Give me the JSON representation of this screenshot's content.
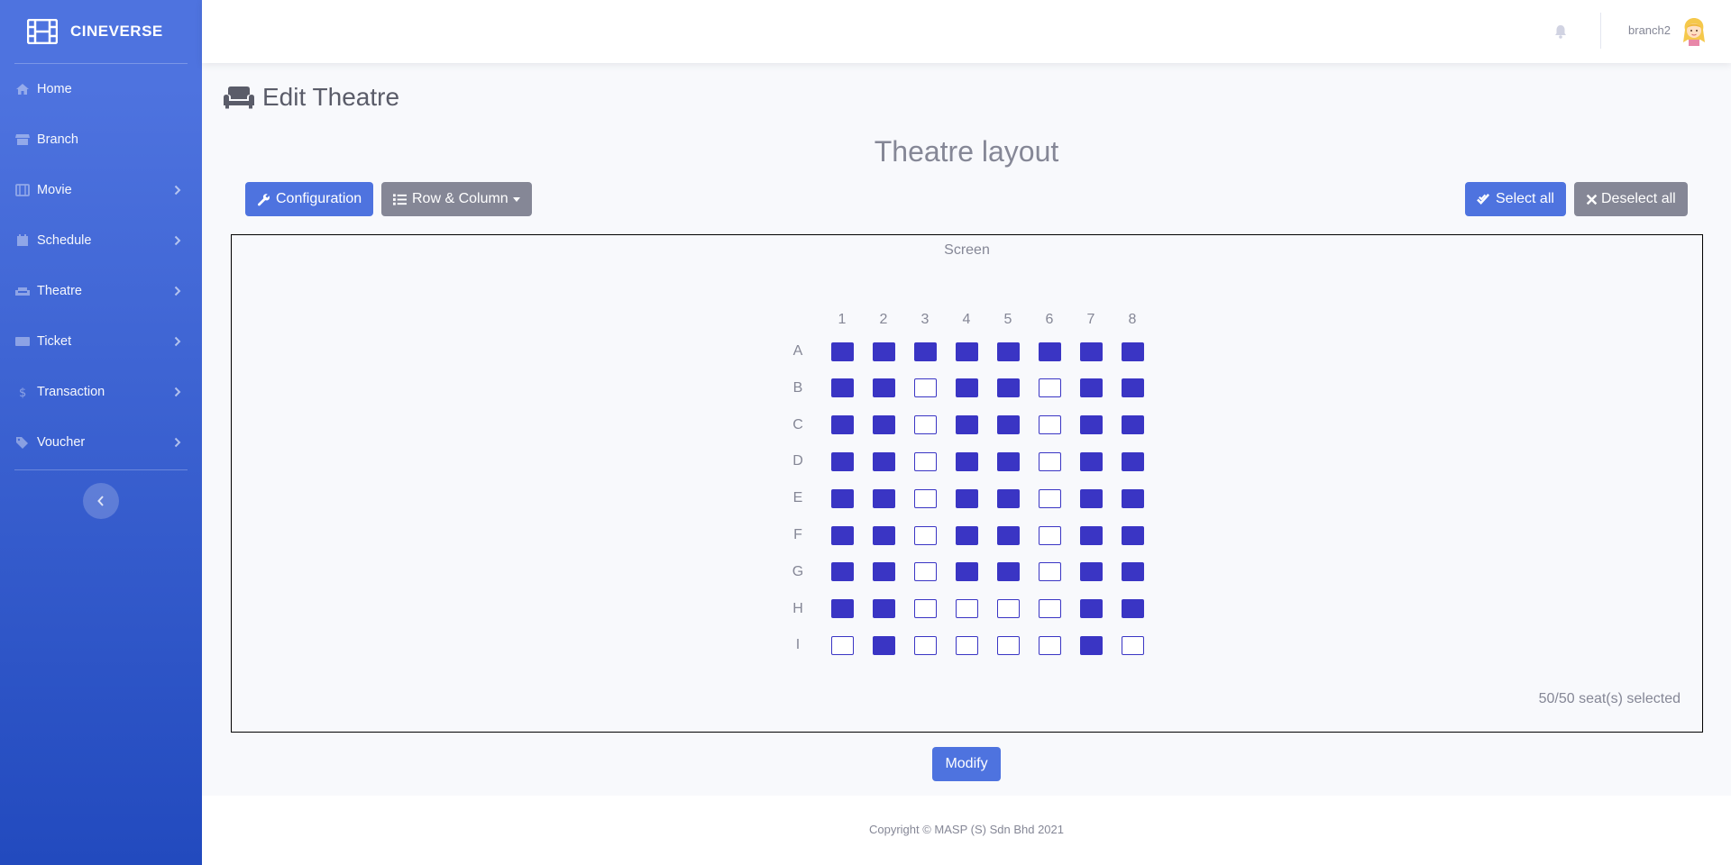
{
  "sidebar": {
    "brand": "CINEVERSE",
    "items": [
      {
        "label": "Home",
        "icon": "home-icon",
        "has_submenu": false
      },
      {
        "label": "Branch",
        "icon": "store-icon",
        "has_submenu": false
      },
      {
        "label": "Movie",
        "icon": "film-icon",
        "has_submenu": true
      },
      {
        "label": "Schedule",
        "icon": "calendar-icon",
        "has_submenu": true
      },
      {
        "label": "Theatre",
        "icon": "couch-icon",
        "has_submenu": true
      },
      {
        "label": "Ticket",
        "icon": "ticket-icon",
        "has_submenu": true
      },
      {
        "label": "Transaction",
        "icon": "dollar-icon",
        "has_submenu": true
      },
      {
        "label": "Voucher",
        "icon": "tags-icon",
        "has_submenu": true
      }
    ]
  },
  "topbar": {
    "username": "branch2"
  },
  "page": {
    "title": "Edit Theatre"
  },
  "layout": {
    "heading": "Theatre layout",
    "configuration_label": "Configuration",
    "row_column_label": "Row & Column",
    "select_all_label": "Select all",
    "deselect_all_label": "Deselect all",
    "screen_label": "Screen",
    "columns": [
      "1",
      "2",
      "3",
      "4",
      "5",
      "6",
      "7",
      "8"
    ],
    "rows": [
      {
        "label": "A",
        "seats": [
          1,
          1,
          1,
          1,
          1,
          1,
          1,
          1
        ]
      },
      {
        "label": "B",
        "seats": [
          1,
          1,
          0,
          1,
          1,
          0,
          1,
          1
        ]
      },
      {
        "label": "C",
        "seats": [
          1,
          1,
          0,
          1,
          1,
          0,
          1,
          1
        ]
      },
      {
        "label": "D",
        "seats": [
          1,
          1,
          0,
          1,
          1,
          0,
          1,
          1
        ]
      },
      {
        "label": "E",
        "seats": [
          1,
          1,
          0,
          1,
          1,
          0,
          1,
          1
        ]
      },
      {
        "label": "F",
        "seats": [
          1,
          1,
          0,
          1,
          1,
          0,
          1,
          1
        ]
      },
      {
        "label": "G",
        "seats": [
          1,
          1,
          0,
          1,
          1,
          0,
          1,
          1
        ]
      },
      {
        "label": "H",
        "seats": [
          1,
          1,
          0,
          0,
          0,
          0,
          1,
          1
        ]
      },
      {
        "label": "I",
        "seats": [
          0,
          1,
          0,
          0,
          0,
          0,
          1,
          0
        ]
      }
    ],
    "selection_text": "50/50 seat(s) selected",
    "modify_label": "Modify"
  },
  "footer": {
    "copyright": "Copyright © MASP (S) Sdn Bhd 2021"
  },
  "colors": {
    "primary": "#4e73df",
    "secondary": "#858796",
    "seat": "#3a35c4"
  }
}
